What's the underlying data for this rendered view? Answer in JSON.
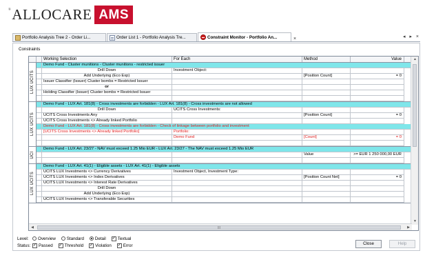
{
  "logo": {
    "reg": "®",
    "text": "ALLOCARE",
    "box": "AMS"
  },
  "tabs": [
    {
      "label": "Portfolio Analysis Tree 2 - Order Li...",
      "icon": "folder-icon"
    },
    {
      "label": "Order List 1 - Portfolio Analysis Tre...",
      "icon": "list-icon"
    },
    {
      "label": "Constraint Monitor - Portfolio An...",
      "icon": "constraint-icon"
    }
  ],
  "tab_close": "×",
  "tab_controls": "◂ ▸ ×",
  "panel_title": "Constraints",
  "columns": {
    "selection": "Working Selection",
    "foreach": "For Each",
    "method": "Method",
    "value": "Value"
  },
  "groups": [
    {
      "side": "LUX UCITS",
      "rows": [
        {
          "type": "title",
          "text": "Demo Fund - Cluster munitions - Cluster munitions - restricted issuer"
        },
        {
          "c1": "Drill Down",
          "c1center": true,
          "c2": "Investment Object:",
          "c3": "",
          "c4": ""
        },
        {
          "c1": "Add Underlying (Eco Exp)",
          "c1center": true,
          "c2": "",
          "c3": "[Position Count]",
          "c4": "= 0"
        },
        {
          "c1": "Issuer Classifier (Issuer) Cluster bombs = Restricted Issuer",
          "c2": "",
          "c3": "",
          "c4": ""
        },
        {
          "c1": "or",
          "c1center": true,
          "c1bold": true,
          "c2": "",
          "c3": "",
          "c4": ""
        },
        {
          "c1": "Holding Classifier (Issuer) Cluster bombs = Restricted Issuer",
          "c2": "",
          "c3": "",
          "c4": ""
        },
        {
          "c1": "",
          "c2": "",
          "c3": "",
          "c4": ""
        }
      ]
    },
    {
      "side": "LUX UCITS",
      "rows": [
        {
          "type": "title",
          "text": "Demo Fund - LUX Art. 181(8) - Cross investments are forbidden - LUX Art. 181(8) - Cross investments are not allowed"
        },
        {
          "c1": "Drill Down",
          "c1center": true,
          "c2": "UCITS Cross Investments:",
          "c3": "",
          "c4": ""
        },
        {
          "c1": "UCITS Cross Investments Any",
          "c2": "",
          "c3": "[Position Count]",
          "c4": "= 0"
        },
        {
          "c1": "UCITS Cross Investments <> Already linked Portfolio",
          "c2": "",
          "c3": "",
          "c4": ""
        },
        {
          "type": "title",
          "red": true,
          "text": "Demo Fund - LUX Art. 181(8) - Cross investments are forbidden - Check of linkage between portfolio and investment"
        },
        {
          "red": true,
          "c1": "[UCITS Cross Investments <> Already linked Portfolio]",
          "c2": "Portfolio:",
          "c3": "",
          "c4": ""
        },
        {
          "red": true,
          "c1": "",
          "c2": "Demo Fund",
          "c3": "[Count]",
          "c4": "= 0"
        },
        {
          "c1": "",
          "c2": "",
          "c3": "",
          "c4": ""
        }
      ]
    },
    {
      "side": "UCI",
      "rows": [
        {
          "type": "title",
          "text": "Demo Fund - LUX Art. 23/27 - NAV must exceed 1.25 Mio EUR - LUX Art. 23/27 - The NAV must exceed 1.25 Mio EUR"
        },
        {
          "c1": "",
          "c2": "",
          "c3": "Value",
          "c4": ">= EUR 1 250 000,00 EUR"
        },
        {
          "c1": "",
          "c2": "",
          "c3": "",
          "c4": ""
        }
      ]
    },
    {
      "side": "LUX UCITS",
      "rows": [
        {
          "type": "title",
          "text": "Demo Fund - LUX Art. 41(1) - Eligible assets - LUX Art. 41(1) - Eligible assets"
        },
        {
          "c1": "UCITS LUX Investments <> Currency Derivatives",
          "c2": "Investment Object, Investment Type:",
          "c3": "",
          "c4": ""
        },
        {
          "c1": "UCITS LUX Investments <> Index Derivatives",
          "c2": "",
          "c3": "[Position Count Net]",
          "c4": "= 0"
        },
        {
          "c1": "UCITS LUX Investments <> Interest Rate Derivatives",
          "c2": "",
          "c3": "",
          "c4": ""
        },
        {
          "c1": "Drill Down",
          "c1center": true,
          "c2": "",
          "c3": "",
          "c4": ""
        },
        {
          "c1": "Add Underlying (Eco Exp)",
          "c1center": true,
          "c2": "",
          "c3": "",
          "c4": ""
        },
        {
          "c1": "UCITS LUX Investments <> Transferable Securities",
          "c2": "",
          "c3": "",
          "c4": ""
        }
      ]
    }
  ],
  "level": {
    "label": "Level:",
    "options": [
      {
        "label": "Overview",
        "selected": false
      },
      {
        "label": "Standard",
        "selected": false
      },
      {
        "label": "Detail",
        "selected": true
      },
      {
        "label": "Textual",
        "checkbox": true,
        "checked": true
      }
    ]
  },
  "status": {
    "label": "Status:",
    "options": [
      {
        "label": "Passed",
        "checked": true
      },
      {
        "label": "Threshold",
        "checked": true
      },
      {
        "label": "Violation",
        "checked": true
      },
      {
        "label": "Error",
        "checked": true
      }
    ]
  },
  "buttons": {
    "close": "Close",
    "help": "Help"
  },
  "scroll": {
    "up": "▲",
    "down": "▼",
    "left": "◀",
    "right": "▶",
    "grip": "III"
  },
  "colors": {
    "row_highlight": "#7fe6ea",
    "error_text": "#e02020",
    "logo_red": "#c8102e"
  }
}
